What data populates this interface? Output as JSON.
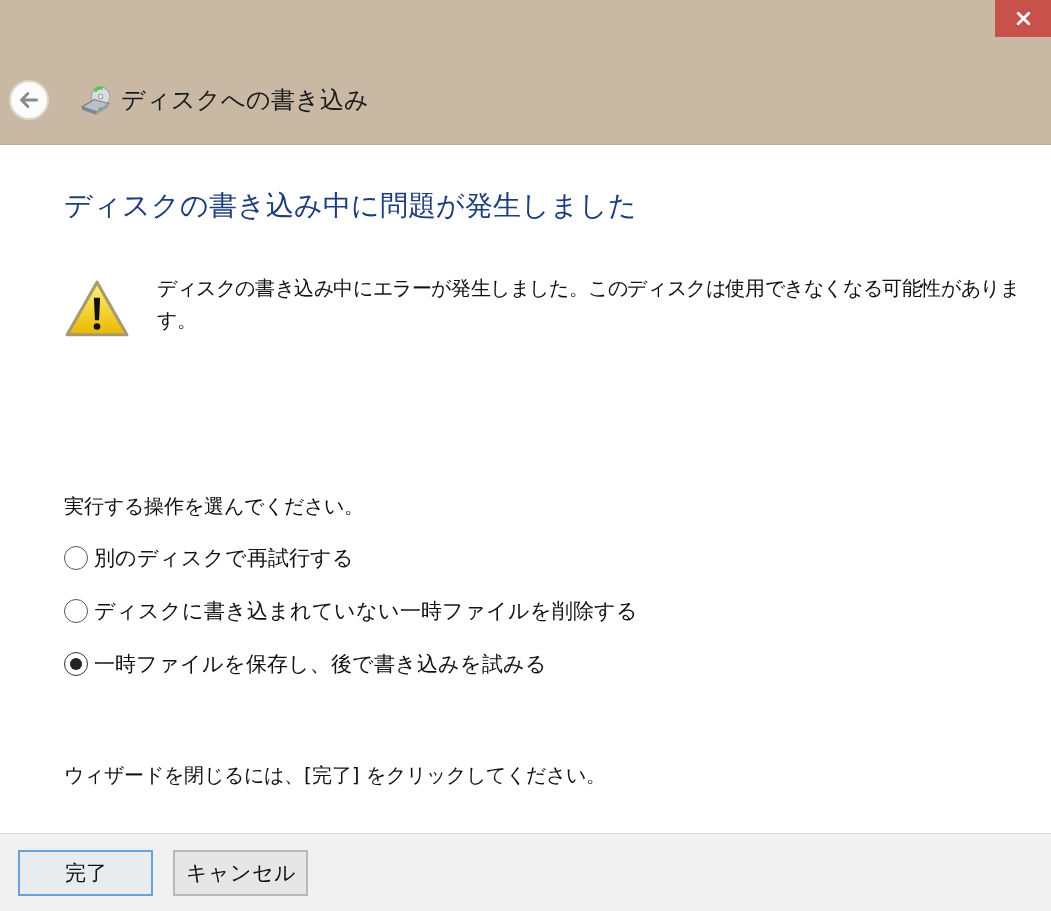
{
  "window": {
    "title": "ディスクへの書き込み"
  },
  "heading": "ディスクの書き込み中に問題が発生しました",
  "message": "ディスクの書き込み中にエラーが発生しました。このディスクは使用できなくなる可能性があります。",
  "prompt": "実行する操作を選んでください。",
  "options": [
    {
      "label": "別のディスクで再試行する",
      "selected": false
    },
    {
      "label": "ディスクに書き込まれていない一時ファイルを削除する",
      "selected": false
    },
    {
      "label": "一時ファイルを保存し、後で書き込みを試みる",
      "selected": true
    }
  ],
  "hint": "ウィザードを閉じるには、[完了] をクリックしてください。",
  "buttons": [
    {
      "label": "完了",
      "kind": "default"
    },
    {
      "label": "キャンセル",
      "kind": "normal"
    }
  ]
}
